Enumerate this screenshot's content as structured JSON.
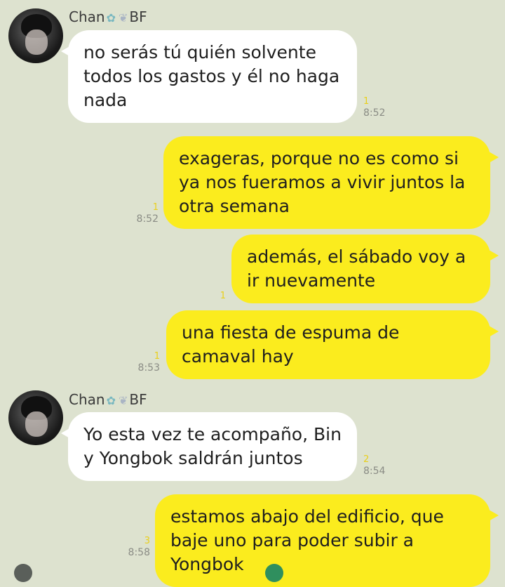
{
  "sender": {
    "name": "Chan",
    "decor_icon_1": "angel-icon",
    "decor_icon_2": "wing-icon",
    "suffix": "BF"
  },
  "messages": [
    {
      "side": "in",
      "text": "no serás tú quién solvente todos los gastos y él no haga nada",
      "read": "1",
      "time": "8:52"
    },
    {
      "side": "out",
      "text": "exageras, porque no es como si ya nos fueramos a vivir juntos la otra semana",
      "read": "1",
      "time": "8:52"
    },
    {
      "side": "out",
      "text": "además, el sábado voy a ir nuevamente",
      "read": "1",
      "time": ""
    },
    {
      "side": "out",
      "text": "una fiesta de espuma de camaval hay",
      "read": "1",
      "time": "8:53"
    },
    {
      "side": "in",
      "text": "Yo esta vez te acompaño, Bin y Yongbok saldrán juntos",
      "read": "2",
      "time": "8:54"
    },
    {
      "side": "out",
      "text": "estamos abajo del edificio, que baje uno para poder subir a Yongbok",
      "read": "3",
      "time": "8:58"
    }
  ],
  "colors": {
    "background": "#dde2cf",
    "incoming_bubble": "#ffffff",
    "outgoing_bubble": "#fbec1e",
    "read_count": "#e9cf1b"
  }
}
